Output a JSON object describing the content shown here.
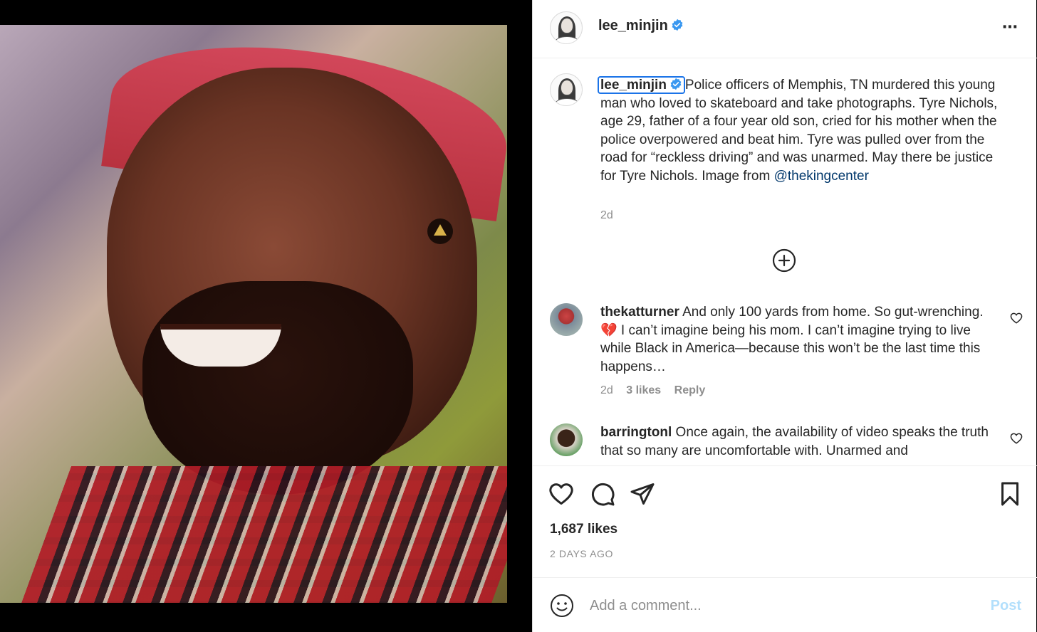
{
  "post": {
    "username": "lee_minjin",
    "verified": true,
    "more_icon": "⋯"
  },
  "caption": {
    "username": "lee_minjin",
    "text": "Police officers of Memphis, TN murdered this young man who loved to skateboard and take photographs. Tyre Nichols, age 29, father of a four year old son, cried for his mother when the police overpowered and beat him. Tyre was pulled over from the road for “reckless driving” and was unarmed. May there be justice for Tyre Nichols. Image from ",
    "mention": "@thekingcenter",
    "time": "2d"
  },
  "comments": [
    {
      "username": "thekatturner",
      "text": " And only 100 yards from home. So gut-wrenching. 💔 I can’t imagine being his mom. I can’t imagine trying to live while Black in America—because this won’t be the last time this happens…",
      "time": "2d",
      "likes": "3 likes",
      "reply": "Reply"
    },
    {
      "username": "barringtonl",
      "text": " Once again, the availability of video speaks the truth that so many are uncomfortable with. Unarmed and"
    }
  ],
  "stats": {
    "likes": "1,687 likes",
    "ago": "2 DAYS AGO"
  },
  "composer": {
    "placeholder": "Add a comment...",
    "post_label": "Post"
  },
  "colors": {
    "verified": "#3897f0",
    "link": "#00376b",
    "post_disabled": "#b2dffc",
    "muted": "#8e8e8e"
  }
}
